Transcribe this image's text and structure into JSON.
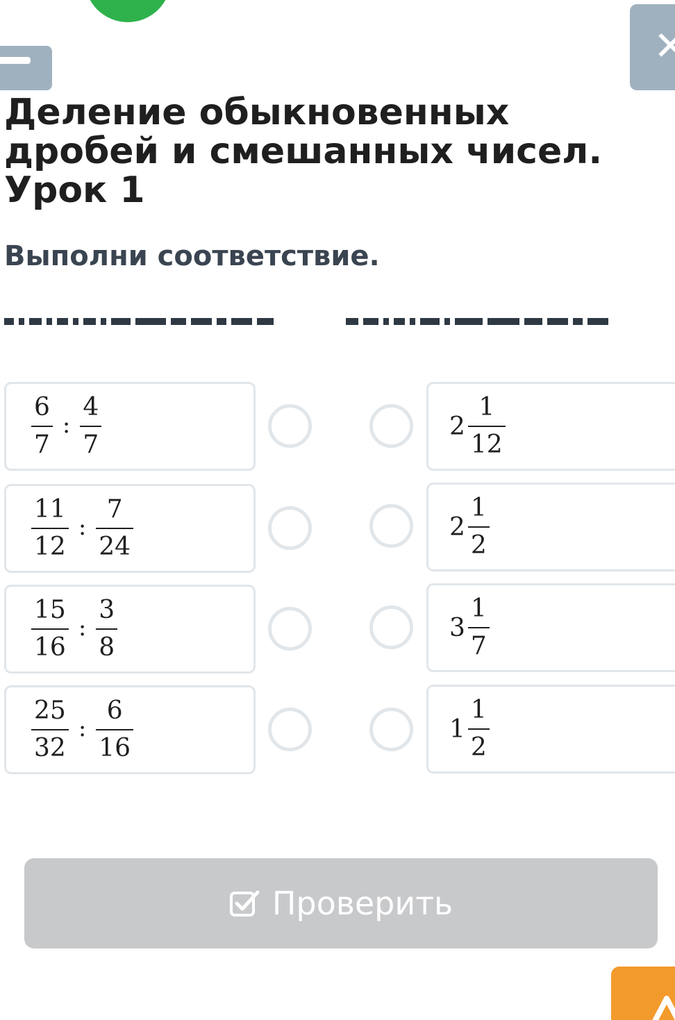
{
  "header": {
    "title": "Деление обыкновенных дробей и смешанных чисел. Урок 1",
    "close_symbol": "✕"
  },
  "task": {
    "instruction": "Выполни соответствие."
  },
  "left_items": [
    {
      "num1": "6",
      "den1": "7",
      "op": ":",
      "num2": "4",
      "den2": "7"
    },
    {
      "num1": "11",
      "den1": "12",
      "op": ":",
      "num2": "7",
      "den2": "24"
    },
    {
      "num1": "15",
      "den1": "16",
      "op": ":",
      "num2": "3",
      "den2": "8"
    },
    {
      "num1": "25",
      "den1": "32",
      "op": ":",
      "num2": "6",
      "den2": "16"
    }
  ],
  "right_items": [
    {
      "whole": "2",
      "num": "1",
      "den": "12"
    },
    {
      "whole": "2",
      "num": "1",
      "den": "2"
    },
    {
      "whole": "3",
      "num": "1",
      "den": "7"
    },
    {
      "whole": "1",
      "num": "1",
      "den": "2"
    }
  ],
  "check_button": {
    "label": "Проверить",
    "icon": "checkbox-icon",
    "state": "disabled"
  },
  "colors": {
    "accent_green": "#2fb24c",
    "nav_gray": "#9fb1bf",
    "button_disabled": "#c8c9cb",
    "orange": "#f39a2c",
    "border": "#e1e6ea"
  }
}
